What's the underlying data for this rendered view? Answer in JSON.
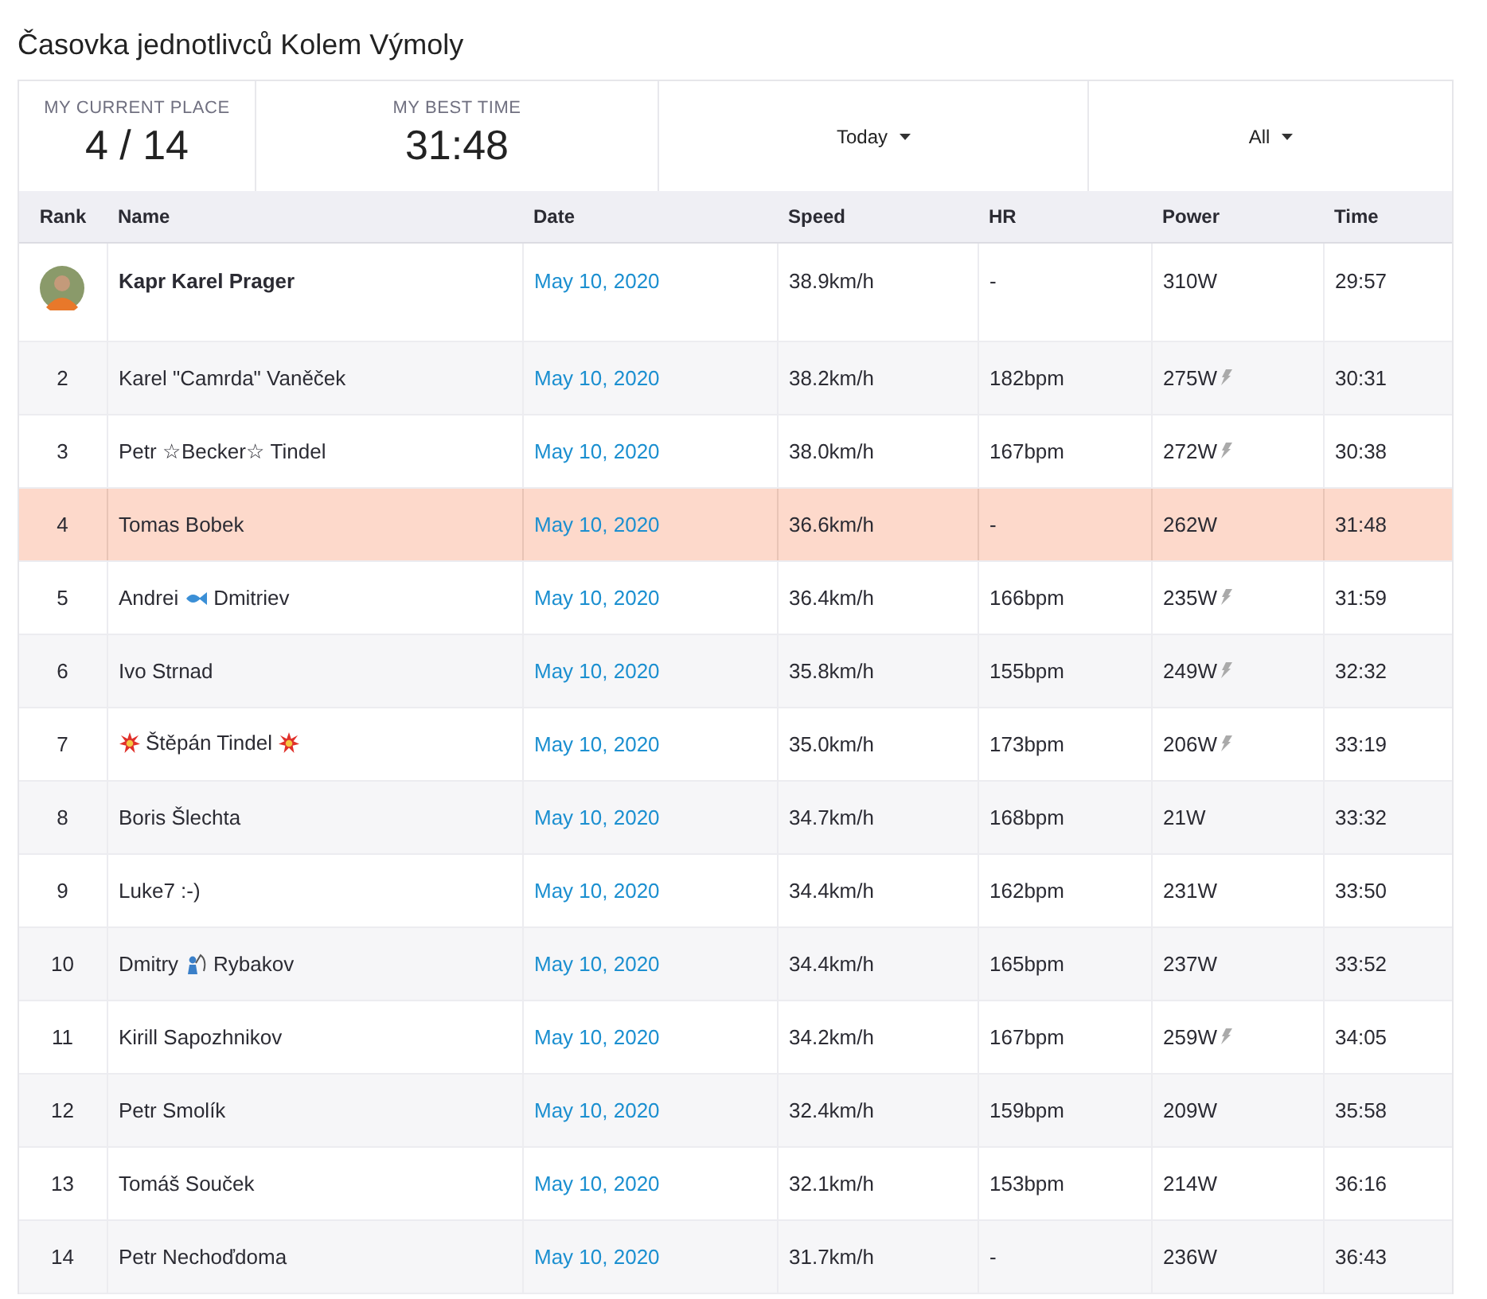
{
  "title": "Časovka jednotlivců Kolem Výmoly",
  "stats": [
    {
      "label": "MY CURRENT PLACE",
      "value": "4 / 14"
    },
    {
      "label": "MY BEST TIME",
      "value": "31:48"
    }
  ],
  "filters": [
    {
      "label": "Today"
    },
    {
      "label": "All"
    }
  ],
  "table": {
    "columns": [
      "Rank",
      "Name",
      "Date",
      "Speed",
      "HR",
      "Power",
      "Time"
    ],
    "rows": [
      {
        "kind": "avatar",
        "name": [
          {
            "kind": "text",
            "text": "Kapr Karel Prager"
          }
        ],
        "date": "May 10, 2020",
        "speed": "38.9km/h",
        "hr": "-",
        "power": "310W",
        "power_marked": false,
        "time": "29:57",
        "selected": false
      },
      {
        "kind": "rank",
        "rank": "2",
        "name": [
          {
            "kind": "text",
            "text": "Karel \"Camrda\" Vaněček"
          }
        ],
        "date": "May 10, 2020",
        "speed": "38.2km/h",
        "hr": "182bpm",
        "power": "275W",
        "power_marked": true,
        "time": "30:31",
        "selected": false
      },
      {
        "kind": "rank",
        "rank": "3",
        "name": [
          {
            "kind": "text",
            "text": "Petr ☆Becker☆ Tindel"
          }
        ],
        "date": "May 10, 2020",
        "speed": "38.0km/h",
        "hr": "167bpm",
        "power": "272W",
        "power_marked": true,
        "time": "30:38",
        "selected": false
      },
      {
        "kind": "rank",
        "rank": "4",
        "name": [
          {
            "kind": "text",
            "text": "Tomas Bobek"
          }
        ],
        "date": "May 10, 2020",
        "speed": "36.6km/h",
        "hr": "-",
        "power": "262W",
        "power_marked": false,
        "time": "31:48",
        "selected": true
      },
      {
        "kind": "rank",
        "rank": "5",
        "name": [
          {
            "kind": "text",
            "text": "Andrei"
          },
          {
            "kind": "fish"
          },
          {
            "kind": "text",
            "text": "Dmitriev"
          }
        ],
        "date": "May 10, 2020",
        "speed": "36.4km/h",
        "hr": "166bpm",
        "power": "235W",
        "power_marked": true,
        "time": "31:59",
        "selected": false
      },
      {
        "kind": "rank",
        "rank": "6",
        "name": [
          {
            "kind": "text",
            "text": "Ivo Strnad"
          }
        ],
        "date": "May 10, 2020",
        "speed": "35.8km/h",
        "hr": "155bpm",
        "power": "249W",
        "power_marked": true,
        "time": "32:32",
        "selected": false
      },
      {
        "kind": "rank",
        "rank": "7",
        "name": [
          {
            "kind": "burst"
          },
          {
            "kind": "text",
            "text": "Štěpán Tindel"
          },
          {
            "kind": "burst"
          }
        ],
        "date": "May 10, 2020",
        "speed": "35.0km/h",
        "hr": "173bpm",
        "power": "206W",
        "power_marked": true,
        "time": "33:19",
        "selected": false
      },
      {
        "kind": "rank",
        "rank": "8",
        "name": [
          {
            "kind": "text",
            "text": "Boris Šlechta"
          }
        ],
        "date": "May 10, 2020",
        "speed": "34.7km/h",
        "hr": "168bpm",
        "power": "21W",
        "power_marked": false,
        "time": "33:32",
        "selected": false
      },
      {
        "kind": "rank",
        "rank": "9",
        "name": [
          {
            "kind": "text",
            "text": "Luke7 :-)"
          }
        ],
        "date": "May 10, 2020",
        "speed": "34.4km/h",
        "hr": "162bpm",
        "power": "231W",
        "power_marked": false,
        "time": "33:50",
        "selected": false
      },
      {
        "kind": "rank",
        "rank": "10",
        "name": [
          {
            "kind": "text",
            "text": "Dmitry"
          },
          {
            "kind": "angler"
          },
          {
            "kind": "text",
            "text": "Rybakov"
          }
        ],
        "date": "May 10, 2020",
        "speed": "34.4km/h",
        "hr": "165bpm",
        "power": "237W",
        "power_marked": false,
        "time": "33:52",
        "selected": false
      },
      {
        "kind": "rank",
        "rank": "11",
        "name": [
          {
            "kind": "text",
            "text": "Kirill Sapozhnikov"
          }
        ],
        "date": "May 10, 2020",
        "speed": "34.2km/h",
        "hr": "167bpm",
        "power": "259W",
        "power_marked": true,
        "time": "34:05",
        "selected": false
      },
      {
        "kind": "rank",
        "rank": "12",
        "name": [
          {
            "kind": "text",
            "text": "Petr Smolík"
          }
        ],
        "date": "May 10, 2020",
        "speed": "32.4km/h",
        "hr": "159bpm",
        "power": "209W",
        "power_marked": false,
        "time": "35:58",
        "selected": false
      },
      {
        "kind": "rank",
        "rank": "13",
        "name": [
          {
            "kind": "text",
            "text": "Tomáš Souček"
          }
        ],
        "date": "May 10, 2020",
        "speed": "32.1km/h",
        "hr": "153bpm",
        "power": "214W",
        "power_marked": false,
        "time": "36:16",
        "selected": false
      },
      {
        "kind": "rank",
        "rank": "14",
        "name": [
          {
            "kind": "text",
            "text": "Petr Nechoďdoma"
          }
        ],
        "date": "May 10, 2020",
        "speed": "31.7km/h",
        "hr": "-",
        "power": "236W",
        "power_marked": false,
        "time": "36:43",
        "selected": false
      }
    ]
  }
}
